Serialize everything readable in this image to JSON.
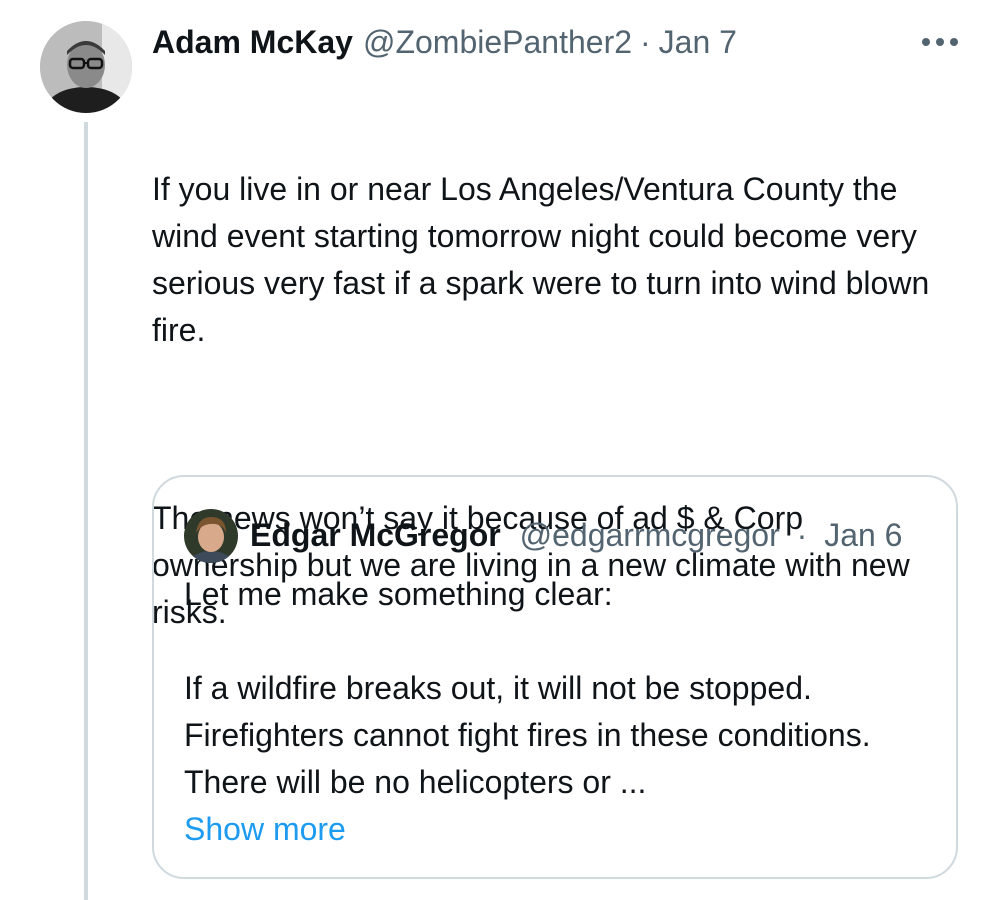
{
  "tweet": {
    "author_name": "Adam McKay",
    "author_handle": "@ZombiePanther2",
    "separator": "·",
    "date": "Jan 7",
    "paragraphs": [
      "If you live in or near Los Angeles/Ventura County the wind event starting tomorrow night could become very serious very fast if a spark were to turn into wind blown fire.",
      "The news won’t say it because of ad $ & Corp ownership but we are living in a new climate with new risks."
    ],
    "more_icon": "more-horizontal-icon"
  },
  "quoted_tweet": {
    "author_name": "Edgar McGregor",
    "author_handle": "@edgarrmcgregor",
    "separator": "·",
    "date": "Jan 6",
    "paragraphs": [
      "Let me make something clear:",
      "If a wildfire breaks out, it will not be stopped. Firefighters cannot fight fires in these conditions. There will be no helicopters or ..."
    ],
    "show_more_label": "Show more"
  },
  "colors": {
    "text": "#0f1419",
    "secondary": "#536471",
    "link": "#1d9bf0",
    "border": "#cfd9de"
  }
}
